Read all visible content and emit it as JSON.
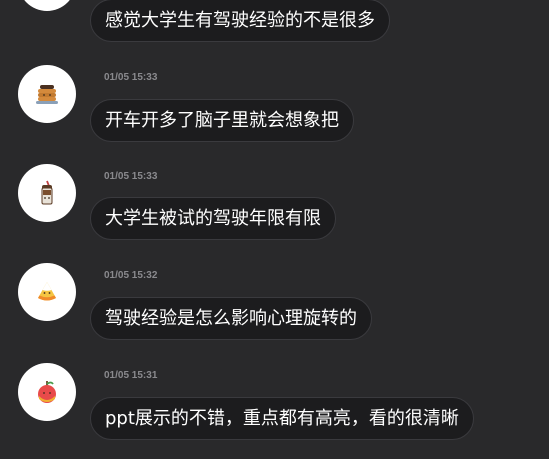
{
  "messages": [
    {
      "avatar_icon": "emoji-avatar-icon",
      "timestamp": "",
      "text": "感觉大学生有驾驶经验的不是很多"
    },
    {
      "avatar_icon": "pancakes-icon",
      "timestamp": "01/05 15:33",
      "text": "开车开多了脑子里就会想象把"
    },
    {
      "avatar_icon": "chocolate-drink-icon",
      "timestamp": "01/05 15:33",
      "text": "大学生被试的驾驶年限有限"
    },
    {
      "avatar_icon": "candy-corn-icon",
      "timestamp": "01/05 15:32",
      "text": "驾驶经验是怎么影响心理旋转的"
    },
    {
      "avatar_icon": "candy-apple-icon",
      "timestamp": "01/05 15:31",
      "text": "ppt展示的不错，重点都有高亮，看的很清晰"
    }
  ],
  "colors": {
    "background": "#29292b",
    "bubble": "#1c1c1e",
    "bubble_border": "#3a3a3e",
    "timestamp": "#8a8a8e",
    "text": "#ffffff"
  }
}
